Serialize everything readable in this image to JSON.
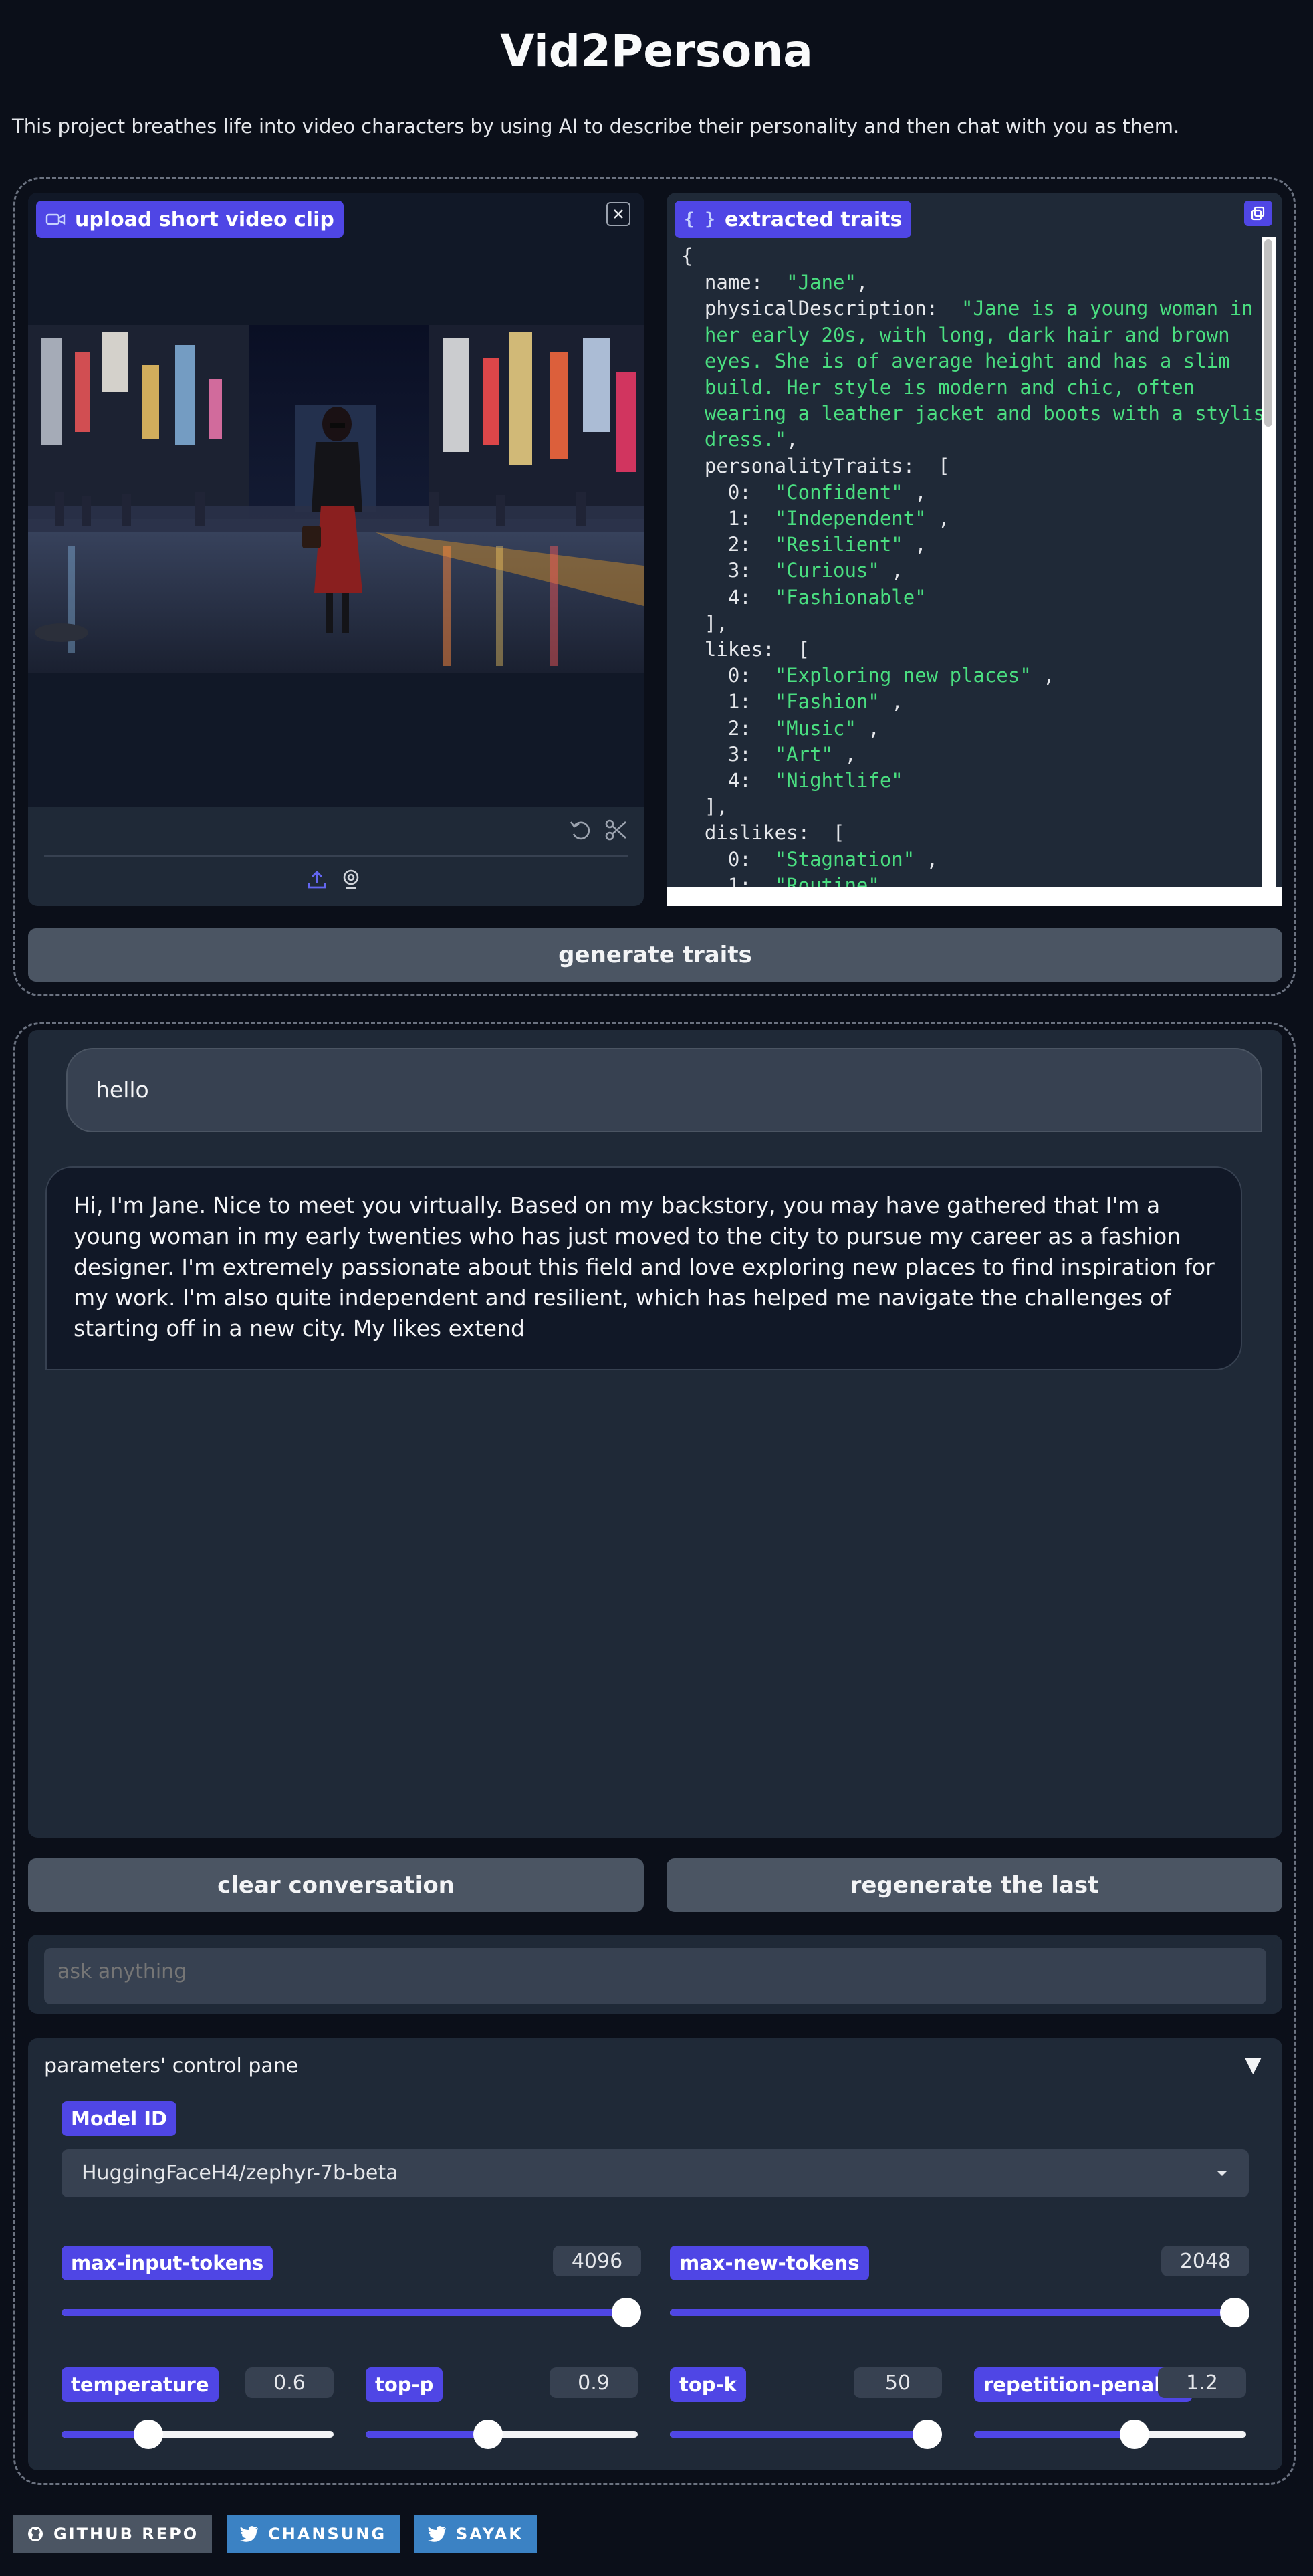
{
  "header": {
    "title": "Vid2Persona",
    "description": "This project breathes life into video characters by using AI to describe their personality and then chat with you as them."
  },
  "video_panel": {
    "label": "upload short video clip"
  },
  "traits_panel": {
    "label": "extracted traits",
    "json_lines": [
      [
        [
          "t",
          "{"
        ]
      ],
      [
        [
          "t",
          "  name:  "
        ],
        [
          "s",
          "\"Jane\""
        ],
        [
          "t",
          ","
        ]
      ],
      [
        [
          "t",
          "  physicalDescription:  "
        ],
        [
          "s",
          "\"Jane is a young woman in"
        ]
      ],
      [
        [
          "s",
          "  her early 20s, with long, dark hair and brown"
        ]
      ],
      [
        [
          "s",
          "  eyes. She is of average height and has a slim"
        ]
      ],
      [
        [
          "s",
          "  build. Her style is modern and chic, often"
        ]
      ],
      [
        [
          "s",
          "  wearing a leather jacket and boots with a stylish"
        ]
      ],
      [
        [
          "s",
          "  dress.\""
        ],
        [
          "t",
          ","
        ]
      ],
      [
        [
          "t",
          "  personalityTraits:  ["
        ]
      ],
      [
        [
          "t",
          "    0:  "
        ],
        [
          "s",
          "\"Confident\""
        ],
        [
          "t",
          " ,"
        ]
      ],
      [
        [
          "t",
          "    1:  "
        ],
        [
          "s",
          "\"Independent\""
        ],
        [
          "t",
          " ,"
        ]
      ],
      [
        [
          "t",
          "    2:  "
        ],
        [
          "s",
          "\"Resilient\""
        ],
        [
          "t",
          " ,"
        ]
      ],
      [
        [
          "t",
          "    3:  "
        ],
        [
          "s",
          "\"Curious\""
        ],
        [
          "t",
          " ,"
        ]
      ],
      [
        [
          "t",
          "    4:  "
        ],
        [
          "s",
          "\"Fashionable\""
        ]
      ],
      [
        [
          "t",
          "  ],"
        ]
      ],
      [
        [
          "t",
          "  likes:  ["
        ]
      ],
      [
        [
          "t",
          "    0:  "
        ],
        [
          "s",
          "\"Exploring new places\""
        ],
        [
          "t",
          " ,"
        ]
      ],
      [
        [
          "t",
          "    1:  "
        ],
        [
          "s",
          "\"Fashion\""
        ],
        [
          "t",
          " ,"
        ]
      ],
      [
        [
          "t",
          "    2:  "
        ],
        [
          "s",
          "\"Music\""
        ],
        [
          "t",
          " ,"
        ]
      ],
      [
        [
          "t",
          "    3:  "
        ],
        [
          "s",
          "\"Art\""
        ],
        [
          "t",
          " ,"
        ]
      ],
      [
        [
          "t",
          "    4:  "
        ],
        [
          "s",
          "\"Nightlife\""
        ]
      ],
      [
        [
          "t",
          "  ],"
        ]
      ],
      [
        [
          "t",
          "  dislikes:  ["
        ]
      ],
      [
        [
          "t",
          "    0:  "
        ],
        [
          "s",
          "\"Stagnation\""
        ],
        [
          "t",
          " ,"
        ]
      ],
      [
        [
          "t",
          "    1:  "
        ],
        [
          "s",
          "\"Routine\""
        ],
        [
          "t",
          " ,"
        ]
      ]
    ]
  },
  "generate_button": "generate traits",
  "chat": {
    "user_message": "hello",
    "bot_message": "Hi, I'm Jane. Nice to meet you virtually. Based on my backstory, you may have gathered that I'm a young woman in my early twenties who has just moved to the city to pursue my career as a fashion designer. I'm extremely passionate about this field and love exploring new places to find inspiration for my work. I'm also quite independent and resilient, which has helped me navigate the challenges of starting off in a new city. My likes extend"
  },
  "buttons": {
    "clear": "clear conversation",
    "regenerate": "regenerate the last"
  },
  "input": {
    "placeholder": "ask anything"
  },
  "params": {
    "title": "parameters' control pane",
    "toggle": "▼",
    "model_label": "Model ID",
    "model_value": "HuggingFaceH4/zephyr-7b-beta",
    "sliders": [
      {
        "label": "max-input-tokens",
        "value": "4096",
        "fraction": 1.0
      },
      {
        "label": "max-new-tokens",
        "value": "2048",
        "fraction": 1.0
      },
      {
        "label": "temperature",
        "value": "0.6",
        "fraction": 0.32
      },
      {
        "label": "top-p",
        "value": "0.9",
        "fraction": 0.45
      },
      {
        "label": "top-k",
        "value": "50",
        "fraction": 0.96
      },
      {
        "label": "repetition-penalty",
        "value": "1.2",
        "fraction": 0.59
      }
    ]
  },
  "footer": {
    "badges": [
      {
        "label": "GITHUB REPO",
        "icon": "github-icon",
        "color": "#4b5563"
      },
      {
        "label": "CHANSUNG",
        "icon": "twitter-icon",
        "color": "#3b82c4"
      },
      {
        "label": "SAYAK",
        "icon": "twitter-icon",
        "color": "#3b82c4"
      }
    ]
  },
  "colors": {
    "accent": "#4f46e5",
    "background": "#0b0f19",
    "panel": "#1f2937",
    "string": "#4ade80"
  }
}
